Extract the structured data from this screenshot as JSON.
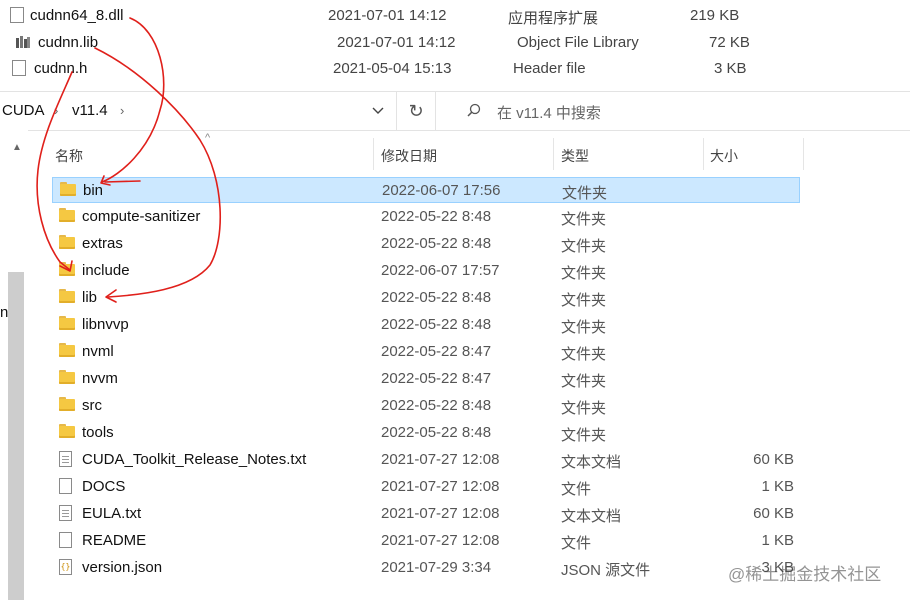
{
  "top_files": [
    {
      "name": "cudnn64_8.dll",
      "date": "2021-07-01 14:12",
      "type": "应用程序扩展",
      "size": "219 KB",
      "icon": "dll-file-icon"
    },
    {
      "name": "cudnn.lib",
      "date": "2021-07-01 14:12",
      "type": "Object File Library",
      "size": "72 KB",
      "icon": "lib-file-icon"
    },
    {
      "name": "cudnn.h",
      "date": "2021-05-04 15:13",
      "type": "Header file",
      "size": "3 KB",
      "icon": "file-icon"
    }
  ],
  "address": {
    "crumbs": [
      "CUDA",
      "v11.4"
    ],
    "search_placeholder": "在 v11.4 中搜索"
  },
  "nav_partial_label": "n",
  "columns": {
    "name": "名称",
    "date": "修改日期",
    "type": "类型",
    "size": "大小"
  },
  "rows": [
    {
      "name": "bin",
      "date": "2022-06-07 17:56",
      "type": "文件夹",
      "size": "",
      "icon": "folder-icon",
      "selected": true
    },
    {
      "name": "compute-sanitizer",
      "date": "2022-05-22 8:48",
      "type": "文件夹",
      "size": "",
      "icon": "folder-icon"
    },
    {
      "name": "extras",
      "date": "2022-05-22 8:48",
      "type": "文件夹",
      "size": "",
      "icon": "folder-icon"
    },
    {
      "name": "include",
      "date": "2022-06-07 17:57",
      "type": "文件夹",
      "size": "",
      "icon": "folder-icon"
    },
    {
      "name": "lib",
      "date": "2022-05-22 8:48",
      "type": "文件夹",
      "size": "",
      "icon": "folder-icon"
    },
    {
      "name": "libnvvp",
      "date": "2022-05-22 8:48",
      "type": "文件夹",
      "size": "",
      "icon": "folder-icon"
    },
    {
      "name": "nvml",
      "date": "2022-05-22 8:47",
      "type": "文件夹",
      "size": "",
      "icon": "folder-icon"
    },
    {
      "name": "nvvm",
      "date": "2022-05-22 8:47",
      "type": "文件夹",
      "size": "",
      "icon": "folder-icon"
    },
    {
      "name": "src",
      "date": "2022-05-22 8:48",
      "type": "文件夹",
      "size": "",
      "icon": "folder-icon"
    },
    {
      "name": "tools",
      "date": "2022-05-22 8:48",
      "type": "文件夹",
      "size": "",
      "icon": "folder-icon"
    },
    {
      "name": "CUDA_Toolkit_Release_Notes.txt",
      "date": "2021-07-27 12:08",
      "type": "文本文档",
      "size": "60 KB",
      "icon": "text-file-icon"
    },
    {
      "name": "DOCS",
      "date": "2021-07-27 12:08",
      "type": "文件",
      "size": "1 KB",
      "icon": "file-icon"
    },
    {
      "name": "EULA.txt",
      "date": "2021-07-27 12:08",
      "type": "文本文档",
      "size": "60 KB",
      "icon": "text-file-icon"
    },
    {
      "name": "README",
      "date": "2021-07-27 12:08",
      "type": "文件",
      "size": "1 KB",
      "icon": "file-icon"
    },
    {
      "name": "version.json",
      "date": "2021-07-29 3:34",
      "type": "JSON 源文件",
      "size": "3 KB",
      "icon": "json-file-icon"
    }
  ],
  "watermark": "@稀土掘金技术社区",
  "colors": {
    "selection_bg": "#cce8ff",
    "selection_border": "#99d1ff",
    "annotation_red": "#e0201b",
    "folder": "#f5c842"
  }
}
